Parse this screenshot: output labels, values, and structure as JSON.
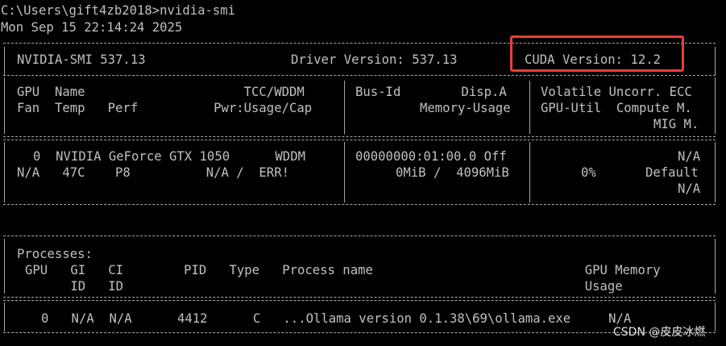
{
  "prompt": {
    "command_line": "C:\\Users\\gift4zb2018>nvidia-smi",
    "timestamp": "Mon Sep 15 22:14:24 2025"
  },
  "header": {
    "smi_version": "NVIDIA-SMI 537.13",
    "driver_version": "Driver Version: 537.13",
    "cuda_version": "CUDA Version: 12.2"
  },
  "gpu_columns": {
    "col1_line1": "GPU  Name                     TCC/WDDM",
    "col1_line2": "Fan  Temp   Perf          Pwr:Usage/Cap",
    "col2_line1": "Bus-Id        Disp.A",
    "col2_line2": "Memory-Usage",
    "col3_line1": "Volatile Uncorr. ECC",
    "col3_line2": "GPU-Util  Compute M.",
    "col3_line3": "MIG M."
  },
  "gpus": [
    {
      "row1_col1": "0  NVIDIA GeForce GTX 1050      WDDM",
      "row2_col1": "N/A   47C    P8          N/A /  ERR!",
      "row1_col2": "00000000:01:00.0 Off",
      "row2_col2": "0MiB /  4096MiB",
      "row1_col3": "N/A",
      "row2_col3_util": "0%",
      "row2_col3_mode": "Default",
      "row3_col3": "N/A"
    }
  ],
  "processes": {
    "title": "Processes:",
    "header_line1": "GPU   GI   CI        PID   Type   Process name                            GPU Memory",
    "header_line2": "      ID   ID                                                             Usage",
    "rows": [
      {
        "line": "0   N/A  N/A      4412      C   ...Ollama version 0.1.38\\69\\ollama.exe     N/A"
      }
    ]
  },
  "watermark": "CSDN @皮皮冰燃",
  "colors": {
    "background": "#000000",
    "text": "#c0c0c0",
    "highlight_box": "#e8403c"
  }
}
